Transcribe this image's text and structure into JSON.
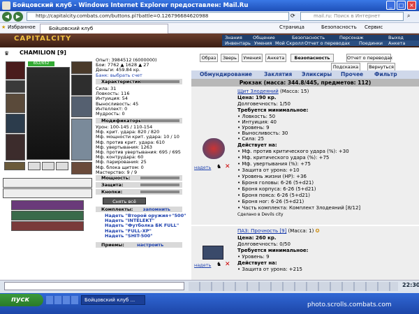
{
  "window": {
    "title": "Бойцовский клуб - Windows Internet Explorer предоставлен: Mail.Ru"
  },
  "address": {
    "url": "http://capitalcity.combats.com/buttons.pl?battle=0.126796684620988",
    "search_placeholder": "mail.ru: Поиск в Интернет"
  },
  "favbar": {
    "favorites": "Избранное",
    "tab": "Бойцовский клуб",
    "page": "Страница",
    "security": "Безопасность",
    "service": "Сервис"
  },
  "site": {
    "logo": "CAPITALCITY",
    "nav_row1": [
      "Знания",
      "Общение",
      "Безопасность",
      "Персонаж",
      "Выход"
    ],
    "nav_row2": [
      "Инвентарь",
      "Умения",
      "Мой Скролл",
      "Отчет о переводах",
      "Поединки",
      "Анкета"
    ]
  },
  "character": {
    "name": "CHAMILION [9]",
    "hp": "652/652",
    "stats": [
      "Опыт: 3984512 (6000000)",
      "Бои:   7762  ▲ 1628 ▲ 27",
      "Деньги: 459.84 кр.",
      "Банк: выбрать счет"
    ],
    "characteristics_header": "Характеристики:",
    "characteristics": [
      "Сила: 31",
      "Ловкость: 116",
      "Интуиция: 54",
      "Выносливость: 45",
      "Интеллект: 0",
      "Мудрость: 0"
    ],
    "modifiers_header": "Модификаторы:",
    "modifiers": [
      "Урон: 100-145 / 110-154",
      "Мф. крит. удара: 820 / 820",
      "Мф. мощности крит. удара: 10 / 10",
      "Мф. против крит. удара: 610",
      "Мф. увертывания: 1263",
      "Мф. против увертывания: 695 / 695",
      "Мф. контрудара: 60",
      "Мф. парирования: 25",
      "Мф. блока щитом: 0",
      "Мастерство: 9 / 9"
    ],
    "power_header": "Мощность:",
    "defense_header": "Защита:",
    "buttons_header": "Кнопки:",
    "remove_all": "Снять всё",
    "sets_header": "Комплекты:",
    "remember": "запомнить",
    "sets": [
      "Надеть \"Второй оружия+\"500\"",
      "Надеть \"INTELEKT\"",
      "Надеть \"Футболка БК FULL\"",
      "Надеть \"FULL-ХР\"",
      "Надеть \"SHIT-500\""
    ],
    "tricks_header": "Приемы:",
    "configure": "настроить"
  },
  "top_buttons": [
    "Образ",
    "Зверь",
    "Умения",
    "Анкета",
    "Безопасность",
    "Отчет о переводах",
    "Подсказка",
    "Вернуться"
  ],
  "inv_tabs": [
    "Обмундирование",
    "Заклятия",
    "Эликсиры",
    "Прочее",
    "Фильтр"
  ],
  "rucksack": "Рюкзак (масса: 344.8/445, предметов: 112)",
  "item1": {
    "name": "Щит Злодеяний",
    "mass": "(Масса: 15)",
    "price": "Цена: 190 кр.",
    "durability": "Долговечность: 1/50",
    "req_header": "Требуется минимальное:",
    "reqs": [
      "• Ловкость: 50",
      "• Интуиция: 40",
      "• Уровень: 9",
      "• Выносливость: 30",
      "• Сила: 25"
    ],
    "acts_header": "Действует на:",
    "acts": [
      "• Мф. против критического удара (%): +30",
      "• Мф. критического удара (%): +75",
      "• Мф. увертывания (%): +75",
      "• Защита от урона: +10",
      "• Уровень жизни (HP): +36",
      "• Броня головы: 6-26 (5+d21)",
      "• Броня корпуса: 6-26 (5+d21)",
      "• Броня пояса: 6-26 (5+d21)",
      "• Броня ног: 6-26 (5+d21)",
      "• Часть комплекта: Комплект Злодеяний [8/12]"
    ],
    "made": "Сделано в Devils city",
    "wear": "надеть"
  },
  "item2": {
    "name": "ПАЗ: Прочность [9]",
    "mass": "(Масса: 1)",
    "price": "Цена: 260 кр.",
    "durability": "Долговечность: 0/50",
    "req_header": "Требуется минимальное:",
    "reqs": [
      "• Уровень: 9"
    ],
    "acts_header": "Действует на:",
    "acts": [
      "• Защита от урона: +215"
    ],
    "wear": "надеть"
  },
  "taskbar": {
    "start": "пуск",
    "item": "Бойцовский клуб ...",
    "clock": "22:30",
    "watermark": "photo.scrolls.combats.com"
  }
}
